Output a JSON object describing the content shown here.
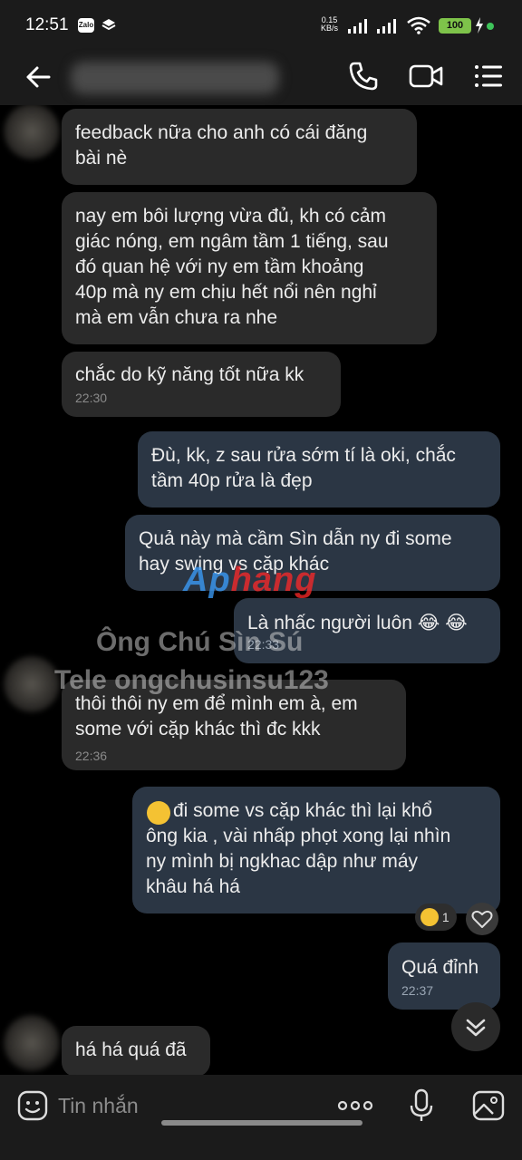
{
  "status_bar": {
    "time": "12:51",
    "zalo_badge": "Zalo",
    "net_speed_value": "0.15",
    "net_speed_unit": "KB/s",
    "battery": "100"
  },
  "header": {
    "contact_name": ""
  },
  "messages": [
    {
      "text": "feedback nữa cho anh có cái đăng\nbài nè",
      "time": ""
    },
    {
      "text": "nay em bôi lượng vừa đủ, kh có cảm\ngiác nóng, em ngâm tầm 1 tiếng, sau\nđó quan hệ với ny em tầm khoảng\n40p mà ny em chịu hết nổi nên nghỉ\nmà em vẫn chưa ra nhe",
      "time": ""
    },
    {
      "text": "chắc do kỹ năng tốt nữa kk",
      "time": "22:30"
    },
    {
      "text": "Đù, kk, z sau rửa sớm tí là oki, chắc\ntầm 40p rửa là đẹp",
      "time": ""
    },
    {
      "text": "Quả này mà cầm Sìn dẫn ny đi some\nhay swing vs cặp khác",
      "time": ""
    },
    {
      "text": "Là nhấc người luôn 😂 😂",
      "time": "22:33"
    },
    {
      "text": "thôi thôi ny em để mình em à, em\nsome với cặp khác thì đc kkk",
      "time": "22:36"
    },
    {
      "text": "đi some vs cặp khác thì lại khổ\nông kia , vài nhấp phọt xong lại nhìn\nny mình bị ngkhac dập như máy\nkhâu há há",
      "time": ""
    },
    {
      "text": "Quá đỉnh",
      "time": "22:37"
    },
    {
      "text": "há há quá đã",
      "time": ""
    }
  ],
  "reaction": {
    "count": "1"
  },
  "watermarks": {
    "logo_left": "Ap",
    "logo_right": "hang",
    "line1": "Ông Chú Sìn Sú",
    "line2": "Tele ongchusinsu123"
  },
  "input": {
    "placeholder": "Tin nhắn"
  },
  "colors": {
    "background": "#000000",
    "bar": "#1b1b1b",
    "incoming_bubble": "#2a2a2a",
    "outgoing_bubble": "#2b3644",
    "battery": "#7ec34a"
  }
}
